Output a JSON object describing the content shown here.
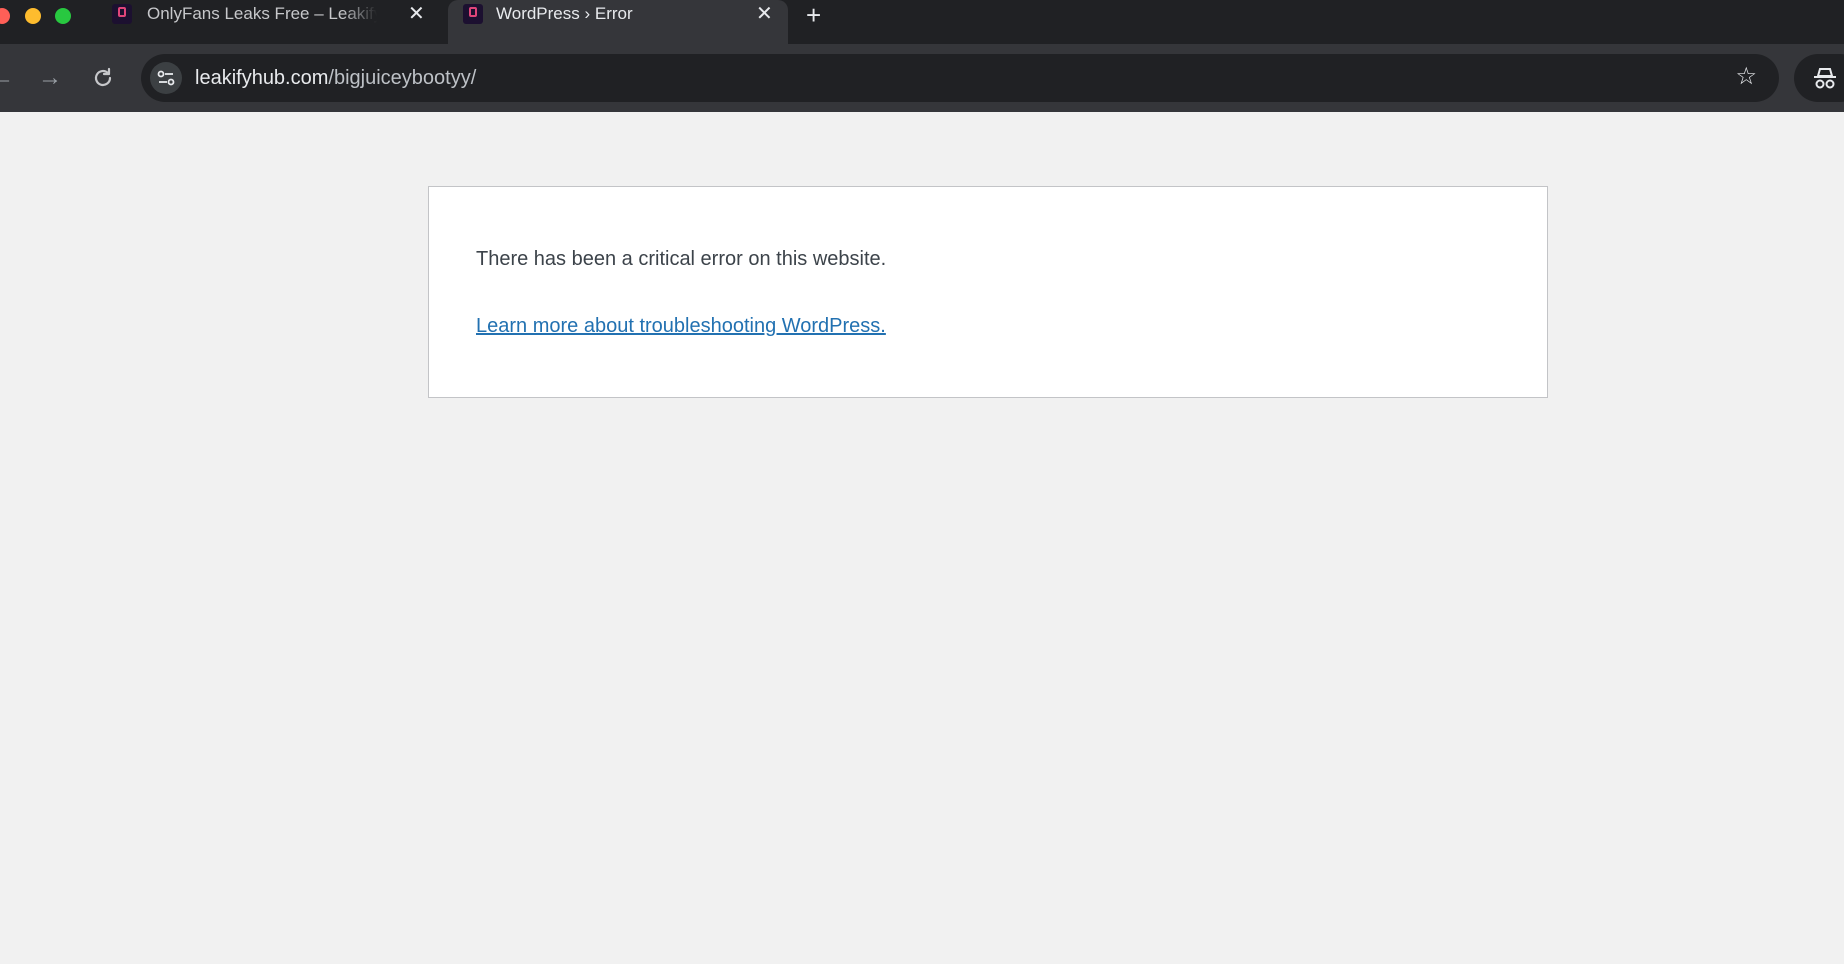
{
  "browser": {
    "tabs": [
      {
        "title": "OnlyFans Leaks Free – Leakify",
        "favicon": "site-favicon",
        "active": false
      },
      {
        "title": "WordPress › Error",
        "favicon": "site-favicon",
        "active": true
      }
    ],
    "new_tab_icon": "plus-icon",
    "url": {
      "domain": "leakifyhub.com",
      "path": "/bigjuiceybootyy/"
    }
  },
  "error_page": {
    "message": "There has been a critical error on this website.",
    "link_text": "Learn more about troubleshooting WordPress."
  },
  "colors": {
    "link": "#2271b1",
    "page_background": "#f1f1f1",
    "text": "#3c434a"
  }
}
